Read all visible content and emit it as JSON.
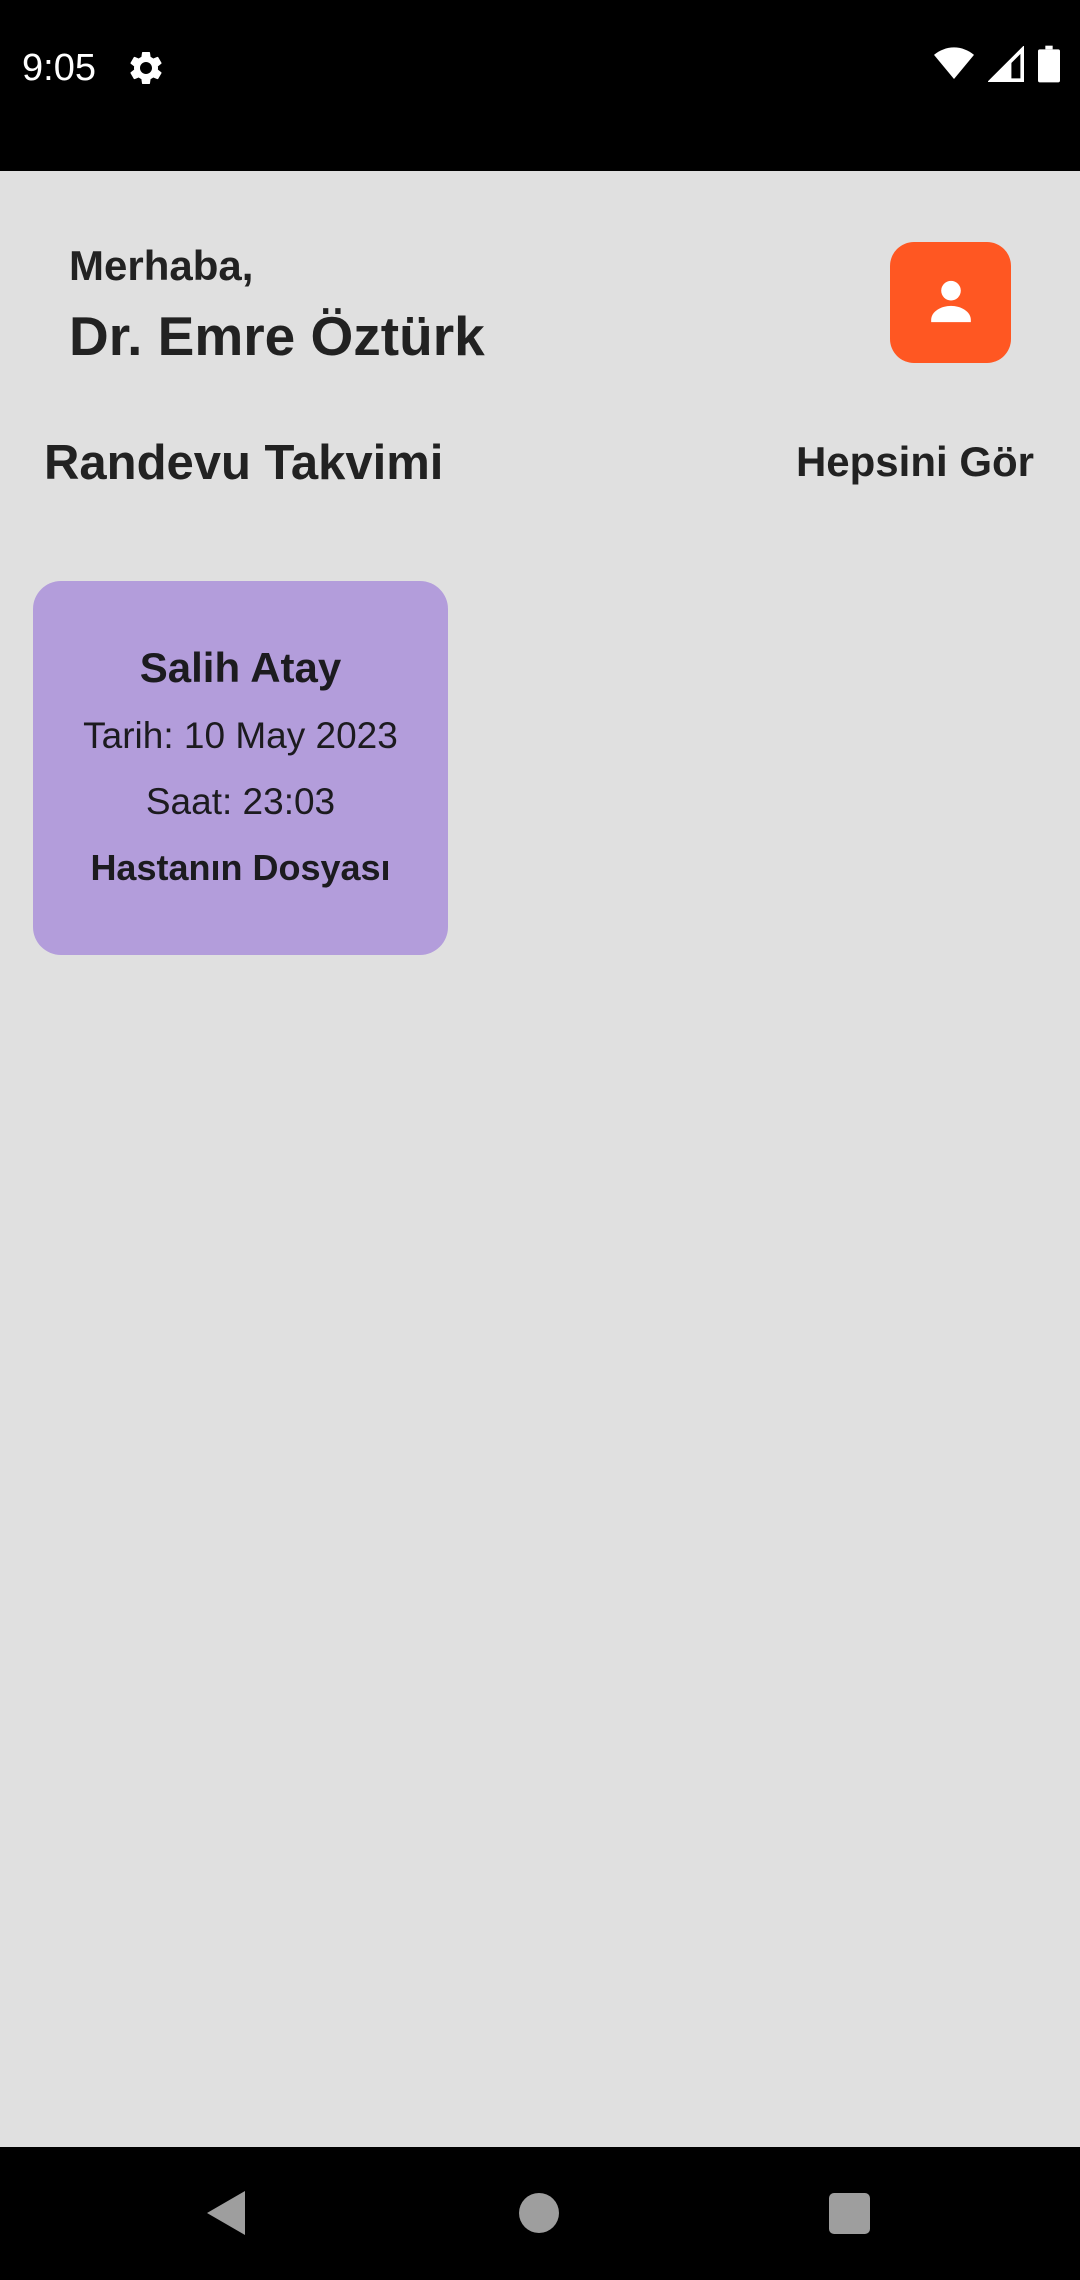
{
  "status_bar": {
    "time": "9:05",
    "icons": [
      "settings-gear-icon",
      "wifi-icon",
      "cell-signal-icon",
      "battery-icon"
    ]
  },
  "header": {
    "greeting": "Merhaba,",
    "doctor_name": "Dr. Emre Öztürk",
    "profile_icon": "person-icon",
    "profile_button_color": "#ff5722"
  },
  "appointments_section": {
    "title": "Randevu Takvimi",
    "see_all_label": "Hepsini Gör"
  },
  "appointments": [
    {
      "patient_name": "Salih Atay",
      "date": "Tarih: 10 May 2023",
      "time": "Saat: 23:03",
      "file_link": "Hastanın Dosyası",
      "card_color": "#b39ddb"
    }
  ],
  "colors": {
    "background": "#e0e0e0",
    "accent": "#ff5722",
    "card": "#b39ddb",
    "text": "#222222"
  },
  "nav_bar": {
    "icons": [
      "back-icon",
      "home-icon",
      "recents-icon"
    ]
  }
}
